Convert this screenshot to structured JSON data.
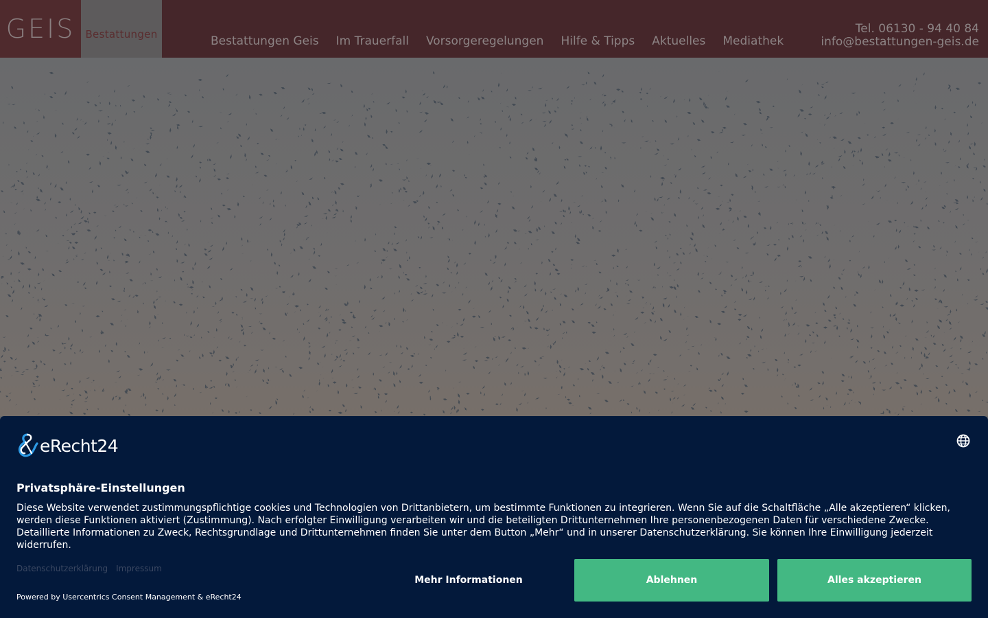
{
  "header": {
    "logo_main": "GEIS",
    "logo_sub": "Bestattungen",
    "nav": [
      {
        "label": "Bestattungen Geis"
      },
      {
        "label": "Im Trauerfall"
      },
      {
        "label": "Vorsorgeregelungen"
      },
      {
        "label": "Hilfe & Tipps"
      },
      {
        "label": "Aktuelles"
      },
      {
        "label": "Mediathek"
      }
    ],
    "phone": "Tel. 06130 - 94 40 84",
    "email": "info@bestattungen-geis.de"
  },
  "hero": {
    "image": "flock-of-birds-sky"
  },
  "consent": {
    "brand": "eRecht24",
    "title": "Privatsphäre-Einstellungen",
    "body": "Diese Website verwendet zustimmungspflichtige cookies und Technologien von Drittanbietern, um bestimmte Funktionen zu integrieren. Wenn Sie auf die Schaltfläche „Alle akzeptieren“ klicken, werden diese Funktionen aktiviert (Zustimmung). Nach erfolgter Einwilligung verarbeiten wir und die beteiligten Drittunternehmen Ihre personenbezogenen Daten für verschiedene Zwecke. Detaillierte Informationen zu Zweck, Rechtsgrundlage und Drittunternehmen finden Sie unter dem Button „Mehr“ und in unserer Datenschutzerklärung. Sie können Ihre Einwilligung jederzeit widerrufen.",
    "link_privacy": "Datenschutzerklärung",
    "link_imprint": "Impressum",
    "powered_by": "Powered by Usercentrics Consent Management & eRecht24",
    "btn_more": "Mehr Informationen",
    "btn_decline": "Ablehnen",
    "btn_accept": "Alles akzeptieren",
    "icons": {
      "language": "globe-icon",
      "brand": "erecht24-logo-icon"
    }
  },
  "colors": {
    "header_bg": "#45262a",
    "consent_bg": "#03193b",
    "button_green": "#43b883"
  }
}
